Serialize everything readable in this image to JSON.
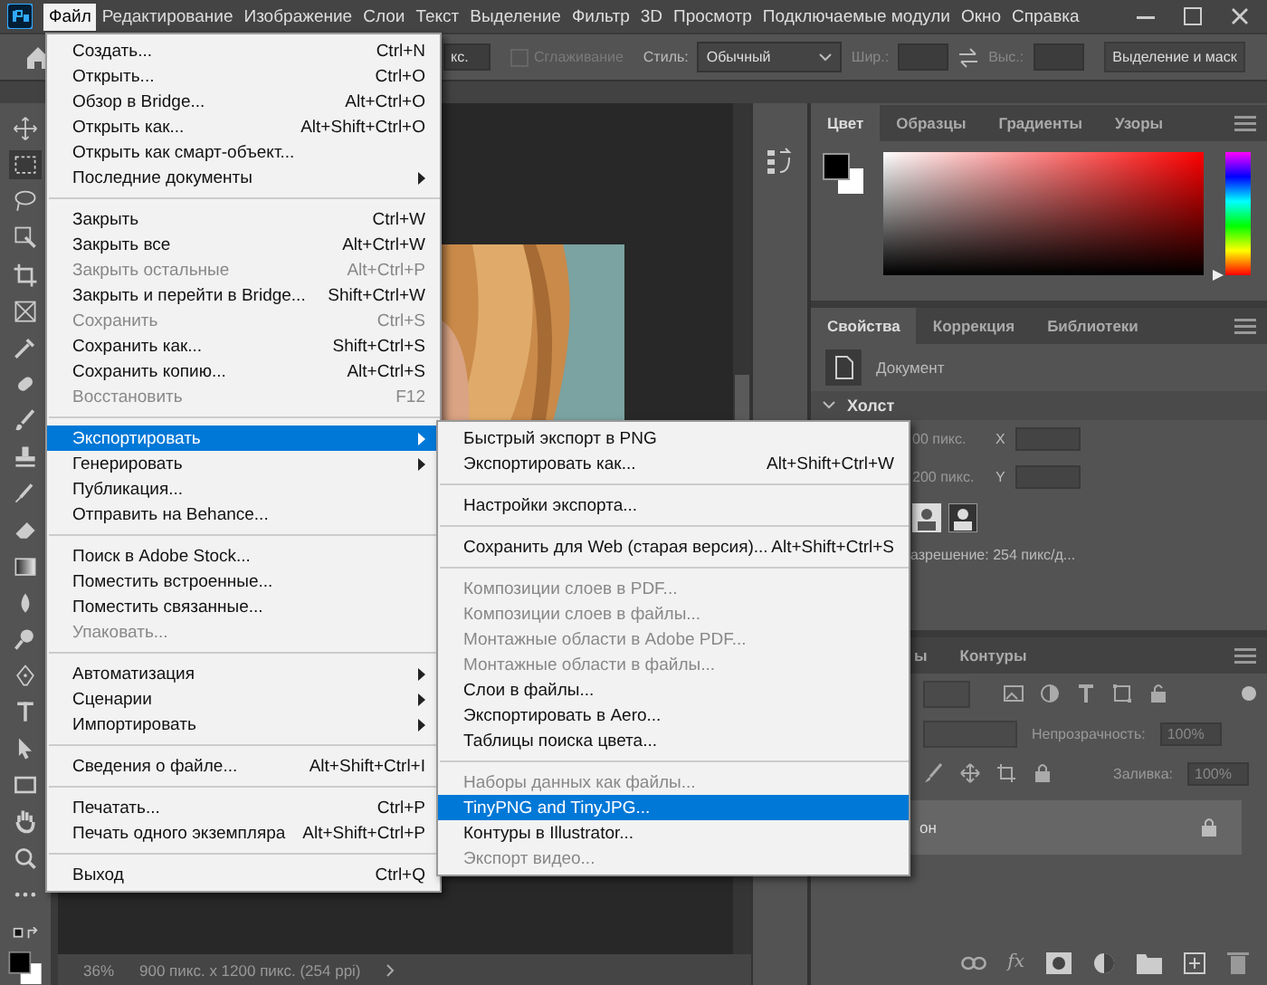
{
  "menu_bar": [
    {
      "label": "Файл",
      "selected": true
    },
    {
      "label": "Редактирование",
      "selected": false
    },
    {
      "label": "Изображение",
      "selected": false
    },
    {
      "label": "Слои",
      "selected": false
    },
    {
      "label": "Текст",
      "selected": false
    },
    {
      "label": "Выделение",
      "selected": false
    },
    {
      "label": "Фильтр",
      "selected": false
    },
    {
      "label": "3D",
      "selected": false
    },
    {
      "label": "Просмотр",
      "selected": false
    },
    {
      "label": "Подключаемые модули",
      "selected": false
    },
    {
      "label": "Окно",
      "selected": false
    },
    {
      "label": "Справка",
      "selected": false
    }
  ],
  "options_bar": {
    "partial_field": "кс.",
    "antialias": {
      "label": "Сглаживание",
      "checked": false,
      "disabled": true
    },
    "style_label": "Стиль:",
    "style_value": "Обычный",
    "width_label": "Шир.:",
    "height_label": "Выс.:",
    "mask_button": "Выделение и маск"
  },
  "file_menu": {
    "items": [
      {
        "kind": "item",
        "label": "Создать...",
        "shortcut": "Ctrl+N",
        "disabled": false,
        "submenu": false,
        "selected": false
      },
      {
        "kind": "item",
        "label": "Открыть...",
        "shortcut": "Ctrl+O",
        "disabled": false,
        "submenu": false,
        "selected": false
      },
      {
        "kind": "item",
        "label": "Обзор в Bridge...",
        "shortcut": "Alt+Ctrl+O",
        "disabled": false,
        "submenu": false,
        "selected": false
      },
      {
        "kind": "item",
        "label": "Открыть как...",
        "shortcut": "Alt+Shift+Ctrl+O",
        "disabled": false,
        "submenu": false,
        "selected": false
      },
      {
        "kind": "item",
        "label": "Открыть как смарт-объект...",
        "disabled": false,
        "submenu": false,
        "selected": false
      },
      {
        "kind": "item",
        "label": "Последние документы",
        "disabled": false,
        "submenu": true,
        "selected": false
      },
      {
        "kind": "separator"
      },
      {
        "kind": "item",
        "label": "Закрыть",
        "shortcut": "Ctrl+W",
        "disabled": false,
        "submenu": false,
        "selected": false
      },
      {
        "kind": "item",
        "label": "Закрыть все",
        "shortcut": "Alt+Ctrl+W",
        "disabled": false,
        "submenu": false,
        "selected": false
      },
      {
        "kind": "item",
        "label": "Закрыть остальные",
        "shortcut": "Alt+Ctrl+P",
        "disabled": true,
        "submenu": false,
        "selected": false
      },
      {
        "kind": "item",
        "label": "Закрыть и перейти в Bridge...",
        "shortcut": "Shift+Ctrl+W",
        "disabled": false,
        "submenu": false,
        "selected": false
      },
      {
        "kind": "item",
        "label": "Сохранить",
        "shortcut": "Ctrl+S",
        "disabled": true,
        "submenu": false,
        "selected": false
      },
      {
        "kind": "item",
        "label": "Сохранить как...",
        "shortcut": "Shift+Ctrl+S",
        "disabled": false,
        "submenu": false,
        "selected": false
      },
      {
        "kind": "item",
        "label": "Сохранить копию...",
        "shortcut": "Alt+Ctrl+S",
        "disabled": false,
        "submenu": false,
        "selected": false
      },
      {
        "kind": "item",
        "label": "Восстановить",
        "shortcut": "F12",
        "disabled": true,
        "submenu": false,
        "selected": false
      },
      {
        "kind": "separator"
      },
      {
        "kind": "item",
        "label": "Экспортировать",
        "disabled": false,
        "submenu": true,
        "selected": true
      },
      {
        "kind": "item",
        "label": "Генерировать",
        "disabled": false,
        "submenu": true,
        "selected": false
      },
      {
        "kind": "item",
        "label": "Публикация...",
        "disabled": false,
        "submenu": false,
        "selected": false
      },
      {
        "kind": "item",
        "label": "Отправить на Behance...",
        "disabled": false,
        "submenu": false,
        "selected": false
      },
      {
        "kind": "separator"
      },
      {
        "kind": "item",
        "label": "Поиск в Adobe Stock...",
        "disabled": false,
        "submenu": false,
        "selected": false
      },
      {
        "kind": "item",
        "label": "Поместить встроенные...",
        "disabled": false,
        "submenu": false,
        "selected": false
      },
      {
        "kind": "item",
        "label": "Поместить связанные...",
        "disabled": false,
        "submenu": false,
        "selected": false
      },
      {
        "kind": "item",
        "label": "Упаковать...",
        "disabled": true,
        "submenu": false,
        "selected": false
      },
      {
        "kind": "separator"
      },
      {
        "kind": "item",
        "label": "Автоматизация",
        "disabled": false,
        "submenu": true,
        "selected": false
      },
      {
        "kind": "item",
        "label": "Сценарии",
        "disabled": false,
        "submenu": true,
        "selected": false
      },
      {
        "kind": "item",
        "label": "Импортировать",
        "disabled": false,
        "submenu": true,
        "selected": false
      },
      {
        "kind": "separator"
      },
      {
        "kind": "item",
        "label": "Сведения о файле...",
        "shortcut": "Alt+Shift+Ctrl+I",
        "disabled": false,
        "submenu": false,
        "selected": false
      },
      {
        "kind": "separator"
      },
      {
        "kind": "item",
        "label": "Печатать...",
        "shortcut": "Ctrl+P",
        "disabled": false,
        "submenu": false,
        "selected": false
      },
      {
        "kind": "item",
        "label": "Печать одного экземпляра",
        "shortcut": "Alt+Shift+Ctrl+P",
        "disabled": false,
        "submenu": false,
        "selected": false
      },
      {
        "kind": "separator"
      },
      {
        "kind": "item",
        "label": "Выход",
        "shortcut": "Ctrl+Q",
        "disabled": false,
        "submenu": false,
        "selected": false
      }
    ]
  },
  "export_submenu": {
    "items": [
      {
        "kind": "item",
        "label": "Быстрый экспорт в PNG",
        "disabled": false,
        "selected": false
      },
      {
        "kind": "item",
        "label": "Экспортировать как...",
        "shortcut": "Alt+Shift+Ctrl+W",
        "disabled": false,
        "selected": false
      },
      {
        "kind": "separator"
      },
      {
        "kind": "item",
        "label": "Настройки экспорта...",
        "disabled": false,
        "selected": false
      },
      {
        "kind": "separator"
      },
      {
        "kind": "item",
        "label": "Сохранить для Web (старая версия)...",
        "shortcut": "Alt+Shift+Ctrl+S",
        "disabled": false,
        "selected": false
      },
      {
        "kind": "separator"
      },
      {
        "kind": "item",
        "label": "Композиции слоев в PDF...",
        "disabled": true,
        "selected": false
      },
      {
        "kind": "item",
        "label": "Композиции слоев в файлы...",
        "disabled": true,
        "selected": false
      },
      {
        "kind": "item",
        "label": "Монтажные области в Adobe PDF...",
        "disabled": true,
        "selected": false
      },
      {
        "kind": "item",
        "label": "Монтажные области в файлы...",
        "disabled": true,
        "selected": false
      },
      {
        "kind": "item",
        "label": "Слои в файлы...",
        "disabled": false,
        "selected": false
      },
      {
        "kind": "item",
        "label": "Экспортировать в Aero...",
        "disabled": false,
        "selected": false
      },
      {
        "kind": "item",
        "label": "Таблицы поиска цвета...",
        "disabled": false,
        "selected": false
      },
      {
        "kind": "separator"
      },
      {
        "kind": "item",
        "label": "Наборы данных как файлы...",
        "disabled": true,
        "selected": false
      },
      {
        "kind": "item",
        "label": "TinyPNG and TinyJPG...",
        "disabled": false,
        "selected": true
      },
      {
        "kind": "item",
        "label": "Контуры в Illustrator...",
        "disabled": false,
        "selected": false
      },
      {
        "kind": "item",
        "label": "Экспорт видео...",
        "disabled": true,
        "selected": false
      }
    ]
  },
  "color_panel": {
    "hue": {
      "level": 0
    },
    "tabs": [
      {
        "label": "Цвет",
        "selected": true
      },
      {
        "label": "Образцы",
        "selected": false
      },
      {
        "label": "Градиенты",
        "selected": false
      },
      {
        "label": "Узоры",
        "selected": false
      }
    ]
  },
  "properties_panel": {
    "tabs": [
      {
        "label": "Свойства",
        "selected": true
      },
      {
        "label": "Коррекция",
        "selected": false
      },
      {
        "label": "Библиотеки",
        "selected": false
      }
    ],
    "document": "Документ",
    "section": "Холст",
    "fields": [
      {
        "value": "00 пикс.",
        "axis": "X"
      },
      {
        "value": "200 пикс.",
        "axis": "Y"
      }
    ],
    "resolution": "азрешение: 254 пикс/д..."
  },
  "layers_panel": {
    "tabs": [
      {
        "label": "ы",
        "selected": false
      },
      {
        "label": "Контуры",
        "selected": false
      }
    ],
    "opacity_label": "Непрозрачность:",
    "opacity": "100%",
    "fill_label": "Заливка:",
    "fill": "100%",
    "layer_name": "он",
    "effects_button": "fx"
  },
  "status_bar": {
    "zoom": "36%",
    "info": "900 пикс. x 1200 пикс. (254 ppi)"
  }
}
